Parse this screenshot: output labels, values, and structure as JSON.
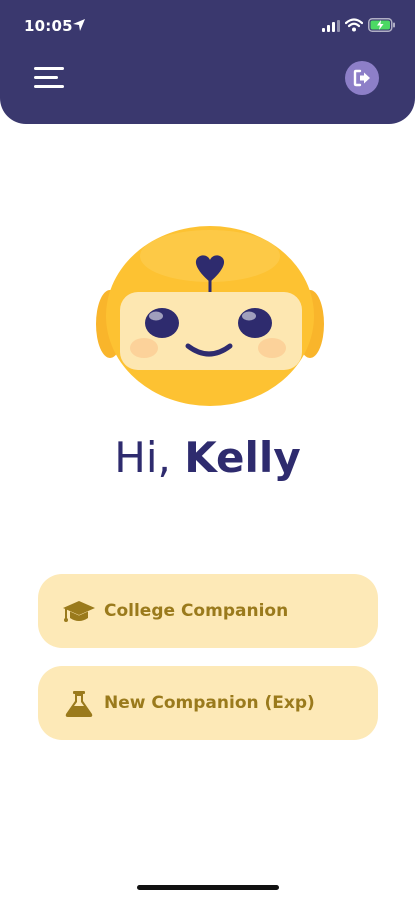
{
  "status_bar": {
    "time": "10:05"
  },
  "greeting": {
    "hi": "Hi, ",
    "name": "Kelly"
  },
  "actions": [
    {
      "label": "College Companion",
      "icon": "graduation-cap-icon"
    },
    {
      "label": "New Companion (Exp)",
      "icon": "flask-icon"
    }
  ],
  "colors": {
    "header_bg": "#3a386e",
    "accent_text": "#2e2b6e",
    "button_bg": "#fde9b7",
    "button_text": "#9a7a1c",
    "mascot_yellow": "#fbc02d",
    "logout_bg": "#8d7fc8"
  }
}
